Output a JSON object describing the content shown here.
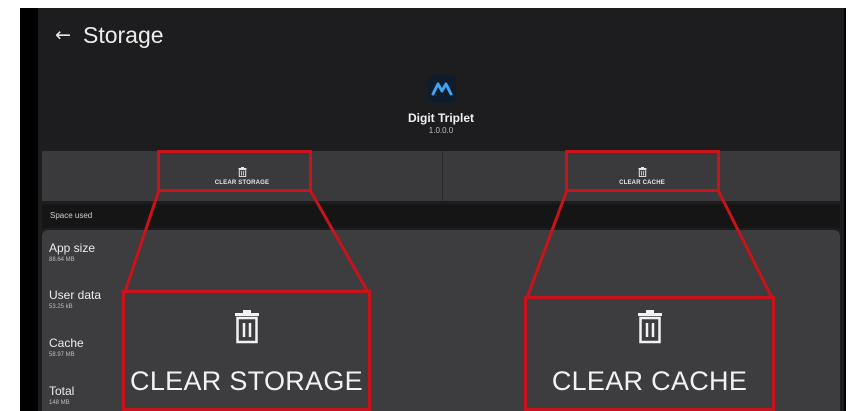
{
  "header": {
    "back_icon": "arrow-back-icon",
    "title": "Storage"
  },
  "app": {
    "icon": "app-logo-icon",
    "name": "Digit Triplet",
    "version": "1.0.0.0",
    "accent_color": "#3ea3f2"
  },
  "actions": {
    "clear_storage_label": "CLEAR STORAGE",
    "clear_cache_label": "CLEAR CACHE",
    "icon": "trash-icon"
  },
  "space": {
    "header": "Space used",
    "rows": [
      {
        "label": "App size",
        "value": "88.64 MB"
      },
      {
        "label": "User data",
        "value": "53.25 kB"
      },
      {
        "label": "Cache",
        "value": "58.97 MB"
      },
      {
        "label": "Total",
        "value": "148 MB"
      }
    ]
  },
  "callouts": {
    "color": "#c8131a",
    "storage_label": "CLEAR STORAGE",
    "cache_label": "CLEAR CACHE"
  }
}
